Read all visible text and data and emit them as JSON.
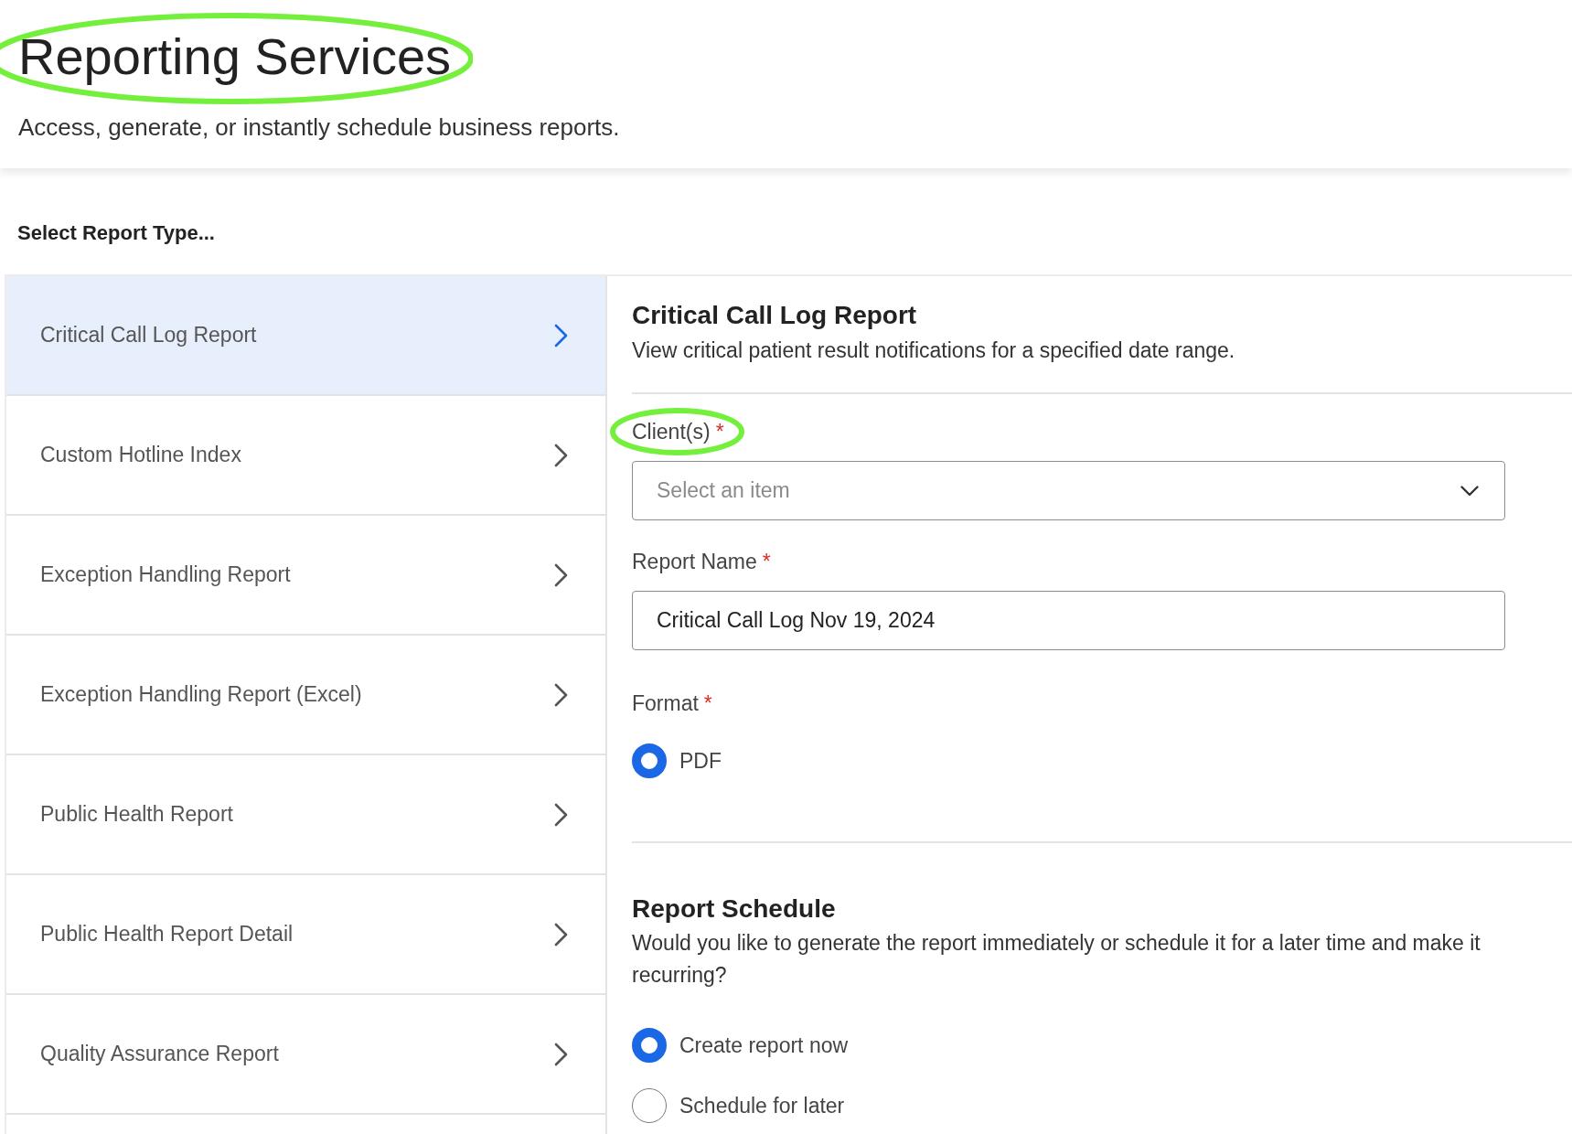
{
  "header": {
    "title": "Reporting Services",
    "title_highlighted": true,
    "subtitle": "Access, generate, or instantly schedule business reports."
  },
  "report_types": {
    "heading": "Select Report Type...",
    "items": [
      {
        "label": "Critical Call Log Report",
        "selected": true
      },
      {
        "label": "Custom Hotline Index",
        "selected": false
      },
      {
        "label": "Exception Handling Report",
        "selected": false
      },
      {
        "label": "Exception Handling Report (Excel)",
        "selected": false
      },
      {
        "label": "Public Health Report",
        "selected": false
      },
      {
        "label": "Public Health Report Detail",
        "selected": false
      },
      {
        "label": "Quality Assurance Report",
        "selected": false
      }
    ]
  },
  "form": {
    "title": "Critical Call Log Report",
    "description": "View critical patient result notifications for a specified date range.",
    "fields": [
      {
        "kind": "select",
        "label": "Client(s)",
        "required_mark": "*",
        "highlighted": true,
        "placeholder": "Select an item"
      },
      {
        "kind": "text",
        "label": "Report Name",
        "required_mark": "*",
        "highlighted": false,
        "value": "Critical Call Log Nov 19, 2024"
      },
      {
        "kind": "radio",
        "label": "Format",
        "required_mark": "*",
        "highlighted": false,
        "options": [
          {
            "label": "PDF",
            "selected": true
          }
        ]
      }
    ]
  },
  "schedule": {
    "title": "Report Schedule",
    "description": "Would you like to generate the report immediately or schedule it for a later time and make it recurring?",
    "options": [
      {
        "label": "Create report now",
        "selected": true
      },
      {
        "label": "Schedule for later",
        "selected": false
      }
    ]
  }
}
